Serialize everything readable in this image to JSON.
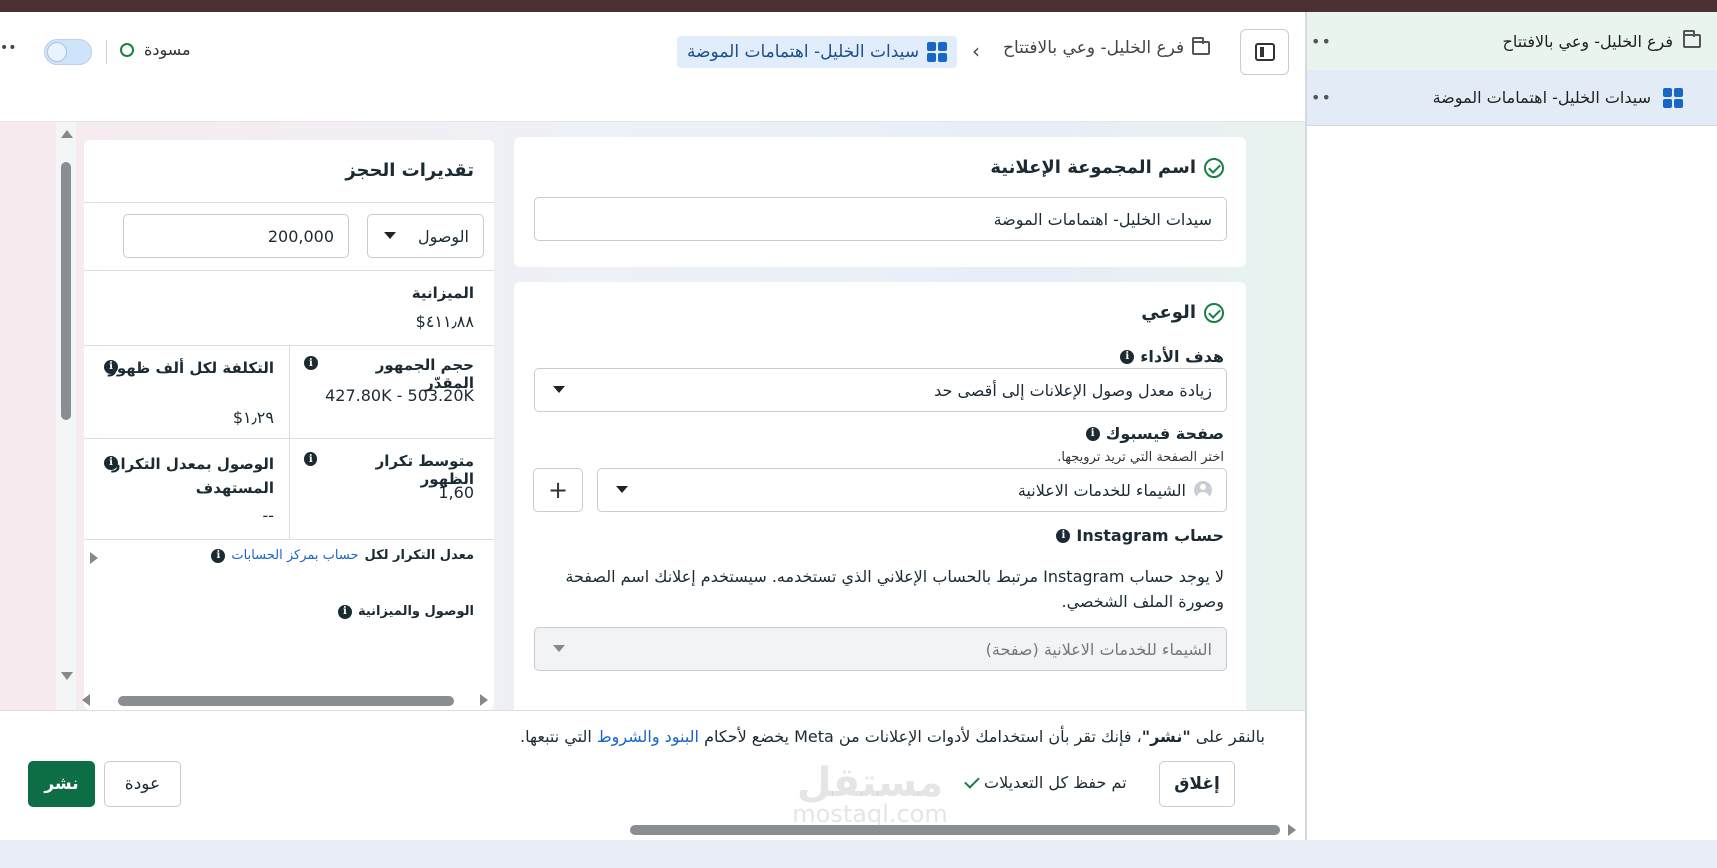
{
  "header": {
    "status_label": "مسودة",
    "breadcrumb_parent": "فرع الخليل- وعي بالافتتاح",
    "breadcrumb_current": "سيدات الخليل- اهتمامات الموضة",
    "more_label": "••"
  },
  "sidebar": {
    "campaign_label": "فرع الخليل- وعي بالافتتاح",
    "adset_label": "سيدات الخليل- اهتمامات الموضة",
    "more_label": "••"
  },
  "adset_name_card": {
    "title": "اسم المجموعة الإعلانية",
    "value": "سيدات الخليل- اهتمامات الموضة"
  },
  "awareness_card": {
    "title": "الوعي",
    "goal_label": "هدف الأداء",
    "goal_value": "زيادة معدل وصول الإعلانات إلى أقصى حد",
    "page_label": "صفحة فيسبوك",
    "page_hint": "اختر الصفحة التي تريد ترويجها.",
    "page_value": "الشيماء للخدمات الاعلانية",
    "plus_label": "+",
    "instagram_label": "حساب Instagram",
    "instagram_text": "لا يوجد حساب Instagram مرتبط بالحساب الإعلاني الذي تستخدمه. سيستخدم إعلانك اسم الصفحة وصورة الملف الشخصي.",
    "instagram_value": "الشيماء للخدمات الاعلانية (صفحة)"
  },
  "estimates": {
    "title": "تقديرات الحجز",
    "metric_select": "الوصول",
    "metric_value": "200,000",
    "budget_label": "الميزانية",
    "budget_value": "٤١١٫٨٨$",
    "audience_label": "حجم الجمهور المقدّر",
    "audience_value": "427.80K - 503.20K",
    "cpm_label": "التكلفة لكل ألف ظهور",
    "cpm_value": "١٫٢٩$",
    "frequency_label": "متوسط تكرار الظهور",
    "frequency_value": "1,60",
    "target_reach_label": "الوصول بمعدل التكرار المستهدف",
    "target_reach_value": "--",
    "freq_rate_prefix": "معدل التكرار لكل",
    "freq_rate_link": "حساب بمركز الحسابات",
    "reach_budget_label": "الوصول والميزانية"
  },
  "footer": {
    "terms_prefix": "بالنقر على ",
    "terms_bold": "\"نشر\"",
    "terms_middle": "، فإنك تقر بأن استخدامك لأدوات الإعلانات من Meta يخضع لأحكام ",
    "terms_link": "البنود والشروط",
    "terms_suffix": " التي نتبعها.",
    "close_label": "إغلاق",
    "saved_label": "تم حفظ كل التعديلات",
    "back_label": "عودة",
    "publish_label": "نشر"
  },
  "watermark": {
    "text": "مستقل",
    "sub": "mostaql.com"
  },
  "colors": {
    "brand_green": "#0d6e45",
    "link_blue": "#1766c8",
    "active_crumb_bg": "#e1edfb"
  },
  "icons": [
    "folder-icon",
    "grid-icon",
    "chevron-left-icon",
    "panel-icon",
    "check-circle-icon",
    "info-icon",
    "caret-down-icon",
    "plus-icon",
    "avatar-icon",
    "check-icon"
  ]
}
